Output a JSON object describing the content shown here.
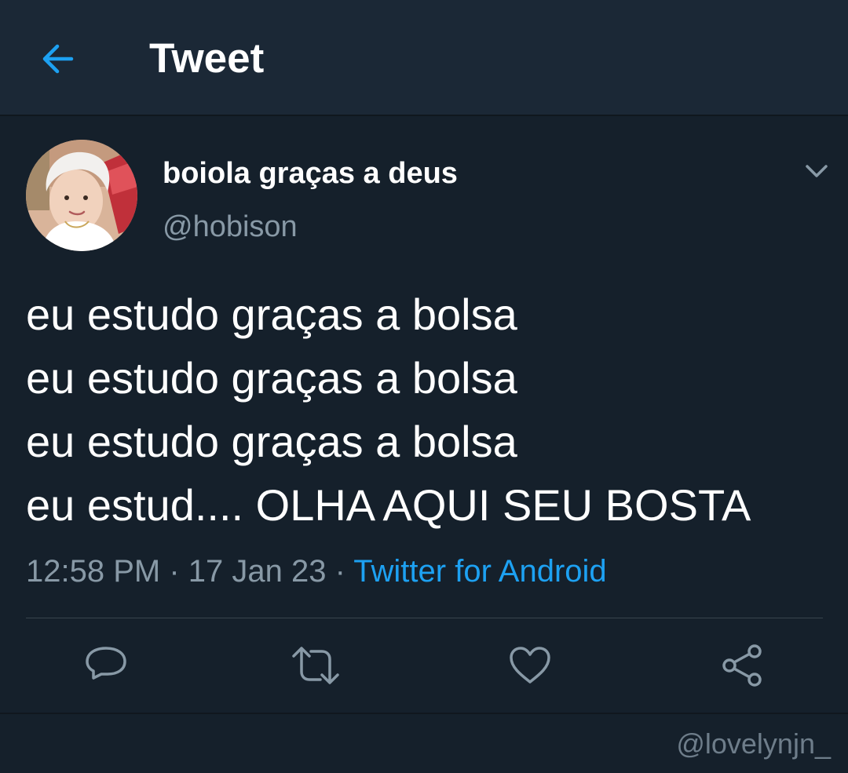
{
  "header": {
    "title": "Tweet",
    "back_icon": "arrow-left-icon"
  },
  "tweet": {
    "display_name": "boiola graças a deus",
    "handle": "@hobison",
    "text_lines": [
      "eu estudo graças a bolsa",
      "eu estudo graças a bolsa",
      "eu estudo graças a bolsa",
      "eu estud.... OLHA AQUI SEU BOSTA"
    ],
    "time": "12:58 PM",
    "date": "17 Jan 23",
    "separator": " · ",
    "source": "Twitter for Android"
  },
  "actions": {
    "reply_icon": "reply-icon",
    "retweet_icon": "retweet-icon",
    "like_icon": "heart-icon",
    "share_icon": "share-icon"
  },
  "watermark": "@lovelynjn_",
  "colors": {
    "background": "#15202b",
    "header_background": "#1b2836",
    "accent": "#1da1f2",
    "secondary_text": "#8899a6",
    "divider": "#38444d"
  }
}
